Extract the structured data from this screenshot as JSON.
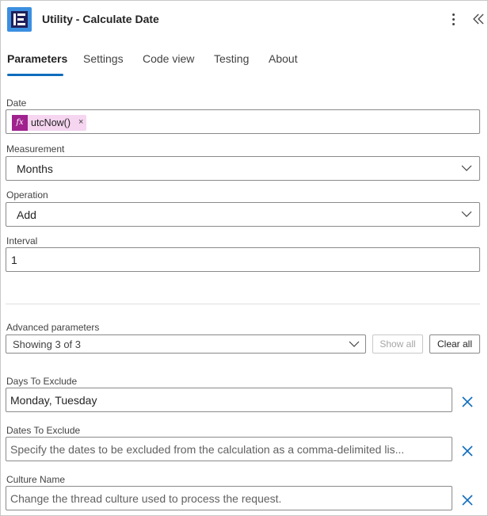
{
  "header": {
    "title": "Utility - Calculate Date",
    "logo_icon": "logo-icon",
    "more_icon": "more-vertical-icon",
    "collapse_icon": "double-chevron-left-icon",
    "accent_color": "#0f6cbd"
  },
  "tabs": [
    {
      "label": "Parameters",
      "active": true
    },
    {
      "label": "Settings",
      "active": false
    },
    {
      "label": "Code view",
      "active": false
    },
    {
      "label": "Testing",
      "active": false
    },
    {
      "label": "About",
      "active": false
    }
  ],
  "parameters": {
    "date": {
      "label": "Date",
      "token_icon": "fx",
      "token_text": "utcNow()",
      "token_remove": "×"
    },
    "measurement": {
      "label": "Measurement",
      "value": "Months"
    },
    "operation": {
      "label": "Operation",
      "value": "Add"
    },
    "interval": {
      "label": "Interval",
      "value": "1"
    }
  },
  "advanced": {
    "label": "Advanced parameters",
    "selected": "Showing 3 of 3",
    "show_all": "Show all",
    "clear_all": "Clear all"
  },
  "advanced_fields": {
    "days_to_exclude": {
      "label": "Days To Exclude",
      "value": "Monday, Tuesday"
    },
    "dates_to_exclude": {
      "label": "Dates To Exclude",
      "placeholder": "Specify the dates to be excluded from the calculation as a comma-delimited lis..."
    },
    "culture_name": {
      "label": "Culture Name",
      "placeholder": "Change the thread culture used to process the request."
    }
  }
}
